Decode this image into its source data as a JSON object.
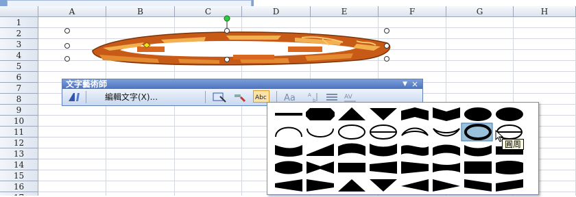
{
  "columns": [
    "A",
    "B",
    "C",
    "D",
    "E",
    "F",
    "G",
    "H"
  ],
  "rows": [
    "1",
    "2",
    "3",
    "4",
    "5",
    "6",
    "7",
    "8",
    "9",
    "10",
    "11",
    "12",
    "13",
    "14",
    "15",
    "16",
    "17"
  ],
  "toolbar": {
    "title": "文字藝術師",
    "edit_text_label": "編輯文字(X)...",
    "menu_arrow": "▼",
    "close": "×",
    "spacing_glyph": "AV"
  },
  "shapes_panel": {
    "rows": 5,
    "cols": 8,
    "selected_index": 14,
    "tooltip": "圓周"
  },
  "wordart": {
    "fill_color": "#c85a18",
    "highlight_color": "#f2b050",
    "shadow_color": "#7a3308"
  }
}
